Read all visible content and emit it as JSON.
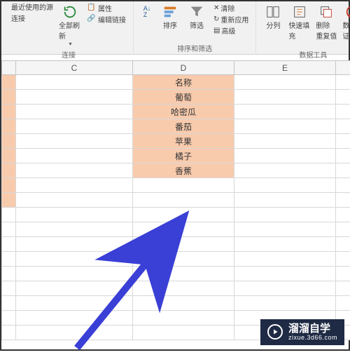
{
  "ribbon": {
    "group_connections": {
      "btn_refresh": "全部刷新",
      "label": "连接",
      "line_a": "最近使用的源",
      "line_b": "连接",
      "line_c": "属性",
      "line_d": "编辑链接"
    },
    "group_sort": {
      "btn_sort": "排序",
      "btn_filter": "筛选",
      "label": "排序和筛选",
      "ln_clear": "清除",
      "ln_reapply": "重新应用",
      "ln_advanced": "高级"
    },
    "group_data": {
      "btn_split": "分列",
      "btn_flash": "快速填充",
      "btn_dedup": "删除重复值",
      "btn_valid": "数据验证",
      "label": "数据工具"
    }
  },
  "columns": {
    "c": "C",
    "d": "D",
    "e": "E"
  },
  "data_rows": [
    "名称",
    "葡萄",
    "哈密瓜",
    "番茄",
    "苹果",
    "橘子",
    "香蕉"
  ],
  "watermark": {
    "main": "溜溜自学",
    "sub": "zixue.3d66.com"
  }
}
